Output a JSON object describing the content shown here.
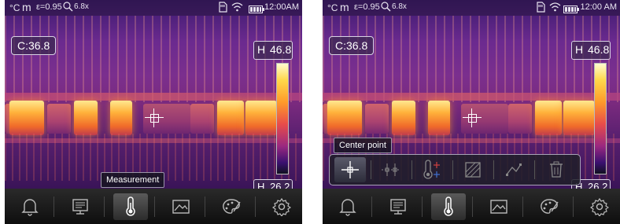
{
  "status_bar": {
    "unit": "°C",
    "mode": "m",
    "emissivity": "ε=0.95",
    "zoom": "6.8x",
    "time": "12:00AM",
    "time_right": "12:00 AM"
  },
  "readout": {
    "center_value": "C:36.8",
    "high_letter": "H",
    "high_value": "46.8",
    "low_letter": "H",
    "low_value": "26.2"
  },
  "left_screen": {
    "tooltip": "Measurement"
  },
  "right_screen": {
    "tooltip": "Center point"
  },
  "dock": {
    "items": [
      "bell-icon",
      "monitor-icon",
      "thermometer-icon",
      "image-icon",
      "palette-icon",
      "gear-icon"
    ],
    "active_index": 2
  },
  "submenu": {
    "items": [
      "center-point-icon",
      "spot-grid-icon",
      "thermometer-spot-icon",
      "area-icon",
      "line-icon",
      "trash-icon"
    ],
    "active_index": 0
  },
  "colors": {
    "scale_top": "#fffbd0",
    "scale_mid": "#e84c4a",
    "scale_bottom": "#101020",
    "hot_spot": "#ffb13a"
  }
}
